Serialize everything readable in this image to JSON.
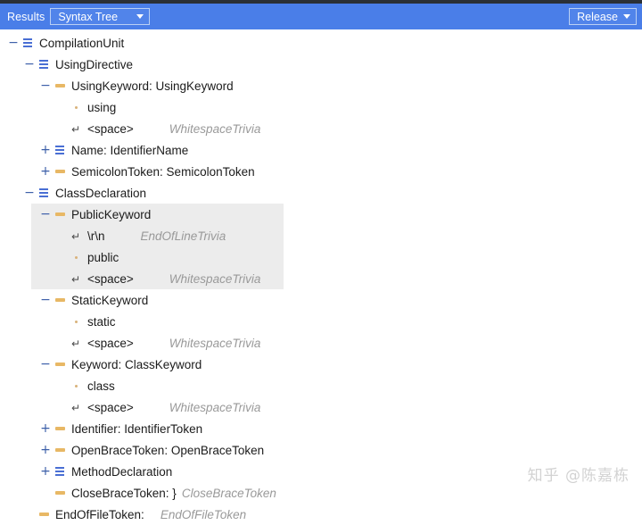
{
  "toolbar": {
    "results_label": "Results",
    "view_select": {
      "value": "Syntax Tree",
      "icon": "chevron-down-icon"
    },
    "config_select": {
      "value": "Release",
      "icon": "chevron-down-icon"
    }
  },
  "colors": {
    "toolbar_bg": "#4a7ee8",
    "node_icon": "#4a6fd4",
    "token_icon": "#e8b865",
    "selection_bg": "#ececec",
    "trivia_text": "#999999"
  },
  "tree": {
    "rows": [
      {
        "depth": 0,
        "expander": "-",
        "icon": "node-icon",
        "label": "CompilationUnit",
        "kind": "",
        "selected": false
      },
      {
        "depth": 1,
        "expander": "-",
        "icon": "node-icon",
        "label": "UsingDirective",
        "kind": "",
        "selected": false
      },
      {
        "depth": 2,
        "expander": "-",
        "icon": "token-icon",
        "label": "UsingKeyword: UsingKeyword",
        "kind": "",
        "selected": false
      },
      {
        "depth": 3,
        "expander": "",
        "icon": "value-dot-icon",
        "label": "using",
        "kind": "",
        "selected": false
      },
      {
        "depth": 3,
        "expander": "",
        "icon": "trivia-icon",
        "label": "<space>",
        "kind": "WhitespaceTrivia",
        "selected": false,
        "gap": "lg"
      },
      {
        "depth": 2,
        "expander": "+",
        "icon": "node-icon",
        "label": "Name: IdentifierName",
        "kind": "",
        "selected": false
      },
      {
        "depth": 2,
        "expander": "+",
        "icon": "token-icon",
        "label": "SemicolonToken: SemicolonToken",
        "kind": "",
        "selected": false
      },
      {
        "depth": 1,
        "expander": "-",
        "icon": "node-icon",
        "label": "ClassDeclaration",
        "kind": "",
        "selected": false
      },
      {
        "depth": 2,
        "expander": "-",
        "icon": "token-icon",
        "label": "PublicKeyword",
        "kind": "",
        "selected": true
      },
      {
        "depth": 3,
        "expander": "",
        "icon": "trivia-icon",
        "label": "\\r\\n",
        "kind": "EndOfLineTrivia",
        "selected": true,
        "gap": "lg"
      },
      {
        "depth": 3,
        "expander": "",
        "icon": "value-dot-icon",
        "label": "public",
        "kind": "",
        "selected": true
      },
      {
        "depth": 3,
        "expander": "",
        "icon": "trivia-icon",
        "label": "<space>",
        "kind": "WhitespaceTrivia",
        "selected": true,
        "gap": "lg"
      },
      {
        "depth": 2,
        "expander": "-",
        "icon": "token-icon",
        "label": "StaticKeyword",
        "kind": "",
        "selected": false
      },
      {
        "depth": 3,
        "expander": "",
        "icon": "value-dot-icon",
        "label": "static",
        "kind": "",
        "selected": false
      },
      {
        "depth": 3,
        "expander": "",
        "icon": "trivia-icon",
        "label": "<space>",
        "kind": "WhitespaceTrivia",
        "selected": false,
        "gap": "lg"
      },
      {
        "depth": 2,
        "expander": "-",
        "icon": "token-icon",
        "label": "Keyword: ClassKeyword",
        "kind": "",
        "selected": false
      },
      {
        "depth": 3,
        "expander": "",
        "icon": "value-dot-icon",
        "label": "class",
        "kind": "",
        "selected": false
      },
      {
        "depth": 3,
        "expander": "",
        "icon": "trivia-icon",
        "label": "<space>",
        "kind": "WhitespaceTrivia",
        "selected": false,
        "gap": "lg"
      },
      {
        "depth": 2,
        "expander": "+",
        "icon": "token-icon",
        "label": "Identifier: IdentifierToken",
        "kind": "",
        "selected": false
      },
      {
        "depth": 2,
        "expander": "+",
        "icon": "token-icon",
        "label": "OpenBraceToken: OpenBraceToken",
        "kind": "",
        "selected": false
      },
      {
        "depth": 2,
        "expander": "+",
        "icon": "node-icon",
        "label": "MethodDeclaration",
        "kind": "",
        "selected": false
      },
      {
        "depth": 2,
        "expander": "",
        "icon": "token-icon",
        "label": "CloseBraceToken: }",
        "kind": "CloseBraceToken",
        "selected": false,
        "gap": "sm"
      },
      {
        "depth": 1,
        "expander": "",
        "icon": "token-icon",
        "label": "EndOfFileToken:",
        "kind": "EndOfFileToken",
        "selected": false,
        "gap": "md"
      }
    ]
  },
  "watermark": {
    "text": "知乎 @陈嘉栋"
  }
}
